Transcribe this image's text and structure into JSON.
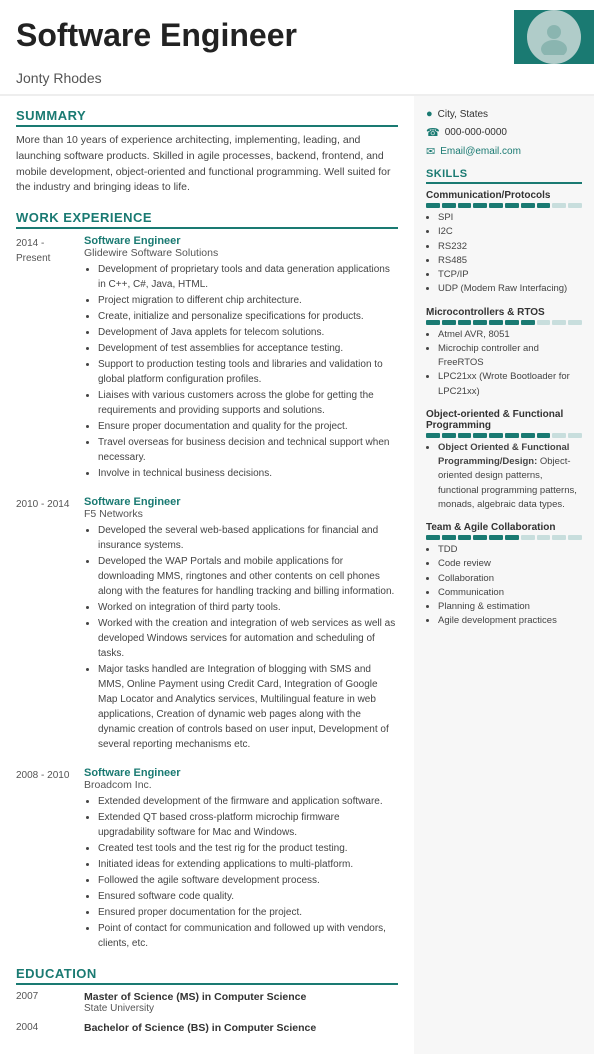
{
  "header": {
    "title": "Software Engineer",
    "name": "Jonty Rhodes"
  },
  "contact": {
    "location": "City, States",
    "phone": "000-000-0000",
    "email": "Email@email.com"
  },
  "summary": {
    "label": "SUMMARY",
    "text": "More than 10 years of experience architecting, implementing, leading, and launching software products. Skilled in agile processes, backend, frontend, and mobile development, object-oriented and functional programming. Well suited for the industry and bringing ideas to life."
  },
  "work_experience": {
    "label": "WORK EXPERIENCE",
    "jobs": [
      {
        "date": "2014 -\nPresent",
        "title": "Software Engineer",
        "company": "Glidewire Software Solutions",
        "bullets": [
          "Development of proprietary tools and data generation applications in C++, C#, Java, HTML.",
          "Project migration to different chip architecture.",
          "Create, initialize and personalize specifications for products.",
          "Development of Java applets for telecom solutions.",
          "Development of test assemblies for acceptance testing.",
          "Support to production testing tools and libraries and validation to global platform configuration profiles.",
          "Liaises with various customers across the globe for getting the requirements and providing supports and solutions.",
          "Ensure proper documentation and quality for the project.",
          "Travel overseas for business decision and technical support when necessary.",
          "Involve in technical business decisions."
        ]
      },
      {
        "date": "2010 - 2014",
        "title": "Software Engineer",
        "company": "F5 Networks",
        "bullets": [
          "Developed the several web-based applications for financial and insurance systems.",
          "Developed the WAP Portals and mobile applications for downloading MMS, ringtones and other contents on cell phones along with the features for handling tracking and billing information.",
          "Worked on integration of third party tools.",
          "Worked with the creation and integration of web services as well as developed Windows services for automation and scheduling of tasks.",
          "Major tasks handled are Integration of blogging with SMS and MMS, Online Payment using Credit Card, Integration of Google Map Locator and Analytics services, Multilingual feature in web applications, Creation of dynamic web pages along with the dynamic creation of controls based on user input, Development of several reporting mechanisms etc."
        ]
      },
      {
        "date": "2008 - 2010",
        "title": "Software Engineer",
        "company": "Broadcom Inc.",
        "bullets": [
          "Extended development of the firmware and application software.",
          "Extended QT based cross-platform microchip firmware upgradability software for Mac and Windows.",
          "Created test tools and the test rig for the product testing.",
          "Initiated ideas for extending applications to multi-platform.",
          "Followed the agile software development process.",
          "Ensured software code quality.",
          "Ensured proper documentation for the project.",
          "Point of contact for communication and followed up with vendors, clients, etc."
        ]
      }
    ]
  },
  "education": {
    "label": "EDUCATION",
    "items": [
      {
        "year": "2007",
        "degree": "Master of Science (MS) in Computer Science",
        "school": "State University"
      },
      {
        "year": "2004",
        "degree": "Bachelor of Science (BS) in Computer Science",
        "school": ""
      }
    ]
  },
  "skills": {
    "label": "SKILLS",
    "groups": [
      {
        "name": "Communication/Protocols",
        "filled": 8,
        "total": 10,
        "items": [
          "SPI",
          "I2C",
          "RS232",
          "RS485",
          "TCP/IP",
          "UDP (Modem Raw Interfacing)"
        ]
      },
      {
        "name": "Microcontrollers & RTOS",
        "filled": 7,
        "total": 10,
        "items": [
          "Atmel AVR, 8051",
          "Microchip controller and FreeRTOS",
          "LPC21xx (Wrote Bootloader for LPC21xx)"
        ]
      },
      {
        "name": "Object-oriented & Functional Programming",
        "filled": 8,
        "total": 10,
        "items_bold": [
          "Object Oriented & Functional Programming/Design:"
        ],
        "items_desc": [
          "Object-oriented design patterns, functional programming patterns, monads, algebraic data types."
        ]
      },
      {
        "name": "Team & Agile Collaboration",
        "filled": 6,
        "total": 10,
        "items": [
          "TDD",
          "Code review",
          "Collaboration",
          "Communication",
          "Planning & estimation",
          "Agile development practices"
        ]
      }
    ]
  }
}
